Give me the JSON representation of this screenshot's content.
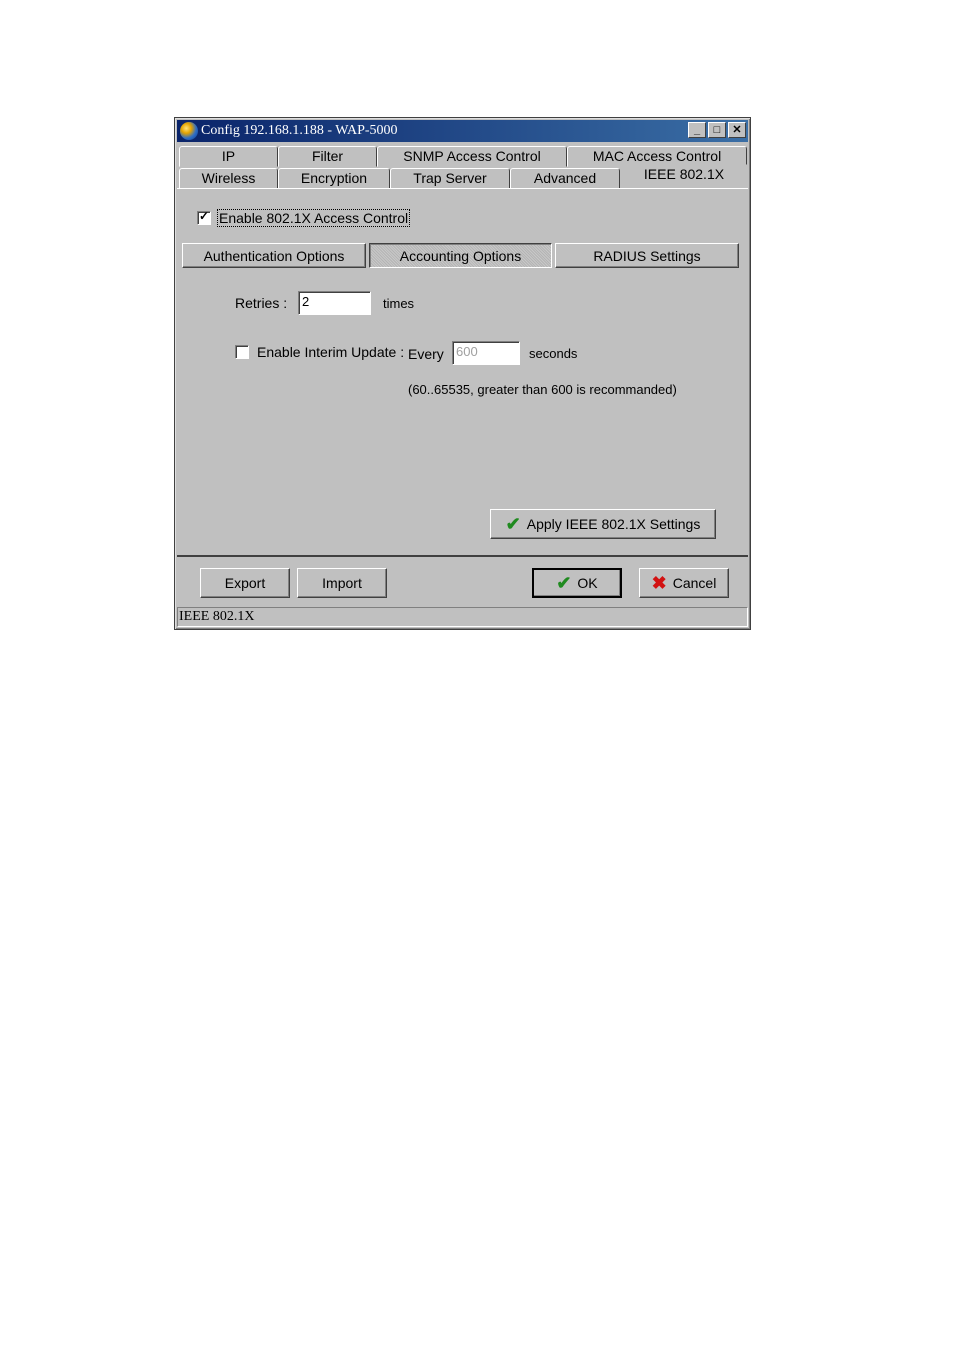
{
  "window": {
    "title": "Config 192.168.1.188 - WAP-5000",
    "minimize": "_",
    "maximize": "□",
    "close": "✕"
  },
  "tabs": {
    "row1": [
      "IP",
      "Filter",
      "SNMP Access Control",
      "MAC Access Control"
    ],
    "row2": [
      "Wireless",
      "Encryption",
      "Trap Server",
      "Advanced",
      "IEEE 802.1X"
    ],
    "active": "IEEE 802.1X"
  },
  "enable_8021x": {
    "label": "Enable 802.1X Access Control",
    "checked": true
  },
  "subtabs": [
    "Authentication Options",
    "Accounting Options",
    "RADIUS Settings"
  ],
  "active_subtab": "Accounting Options",
  "retries": {
    "label": "Retries :",
    "value": "2",
    "unit": "times"
  },
  "interim_update": {
    "label": "Enable Interim Update :",
    "checked": false,
    "every_label": "Every",
    "value": "600",
    "unit": "seconds",
    "hint": "(60..65535, greater than 600 is recommanded)"
  },
  "apply_button": "Apply IEEE 802.1X Settings",
  "bottom_buttons": {
    "export": "Export",
    "import": "Import",
    "ok": "OK",
    "cancel": "Cancel"
  },
  "status_text": "IEEE 802.1X",
  "icons": {
    "check": "check-icon",
    "cancel": "x-icon",
    "app": "app-icon"
  },
  "colors": {
    "titlebar": "#0a246a",
    "face": "#c0c0c0",
    "check": "#1f8a1f",
    "cancel": "#d21212"
  }
}
